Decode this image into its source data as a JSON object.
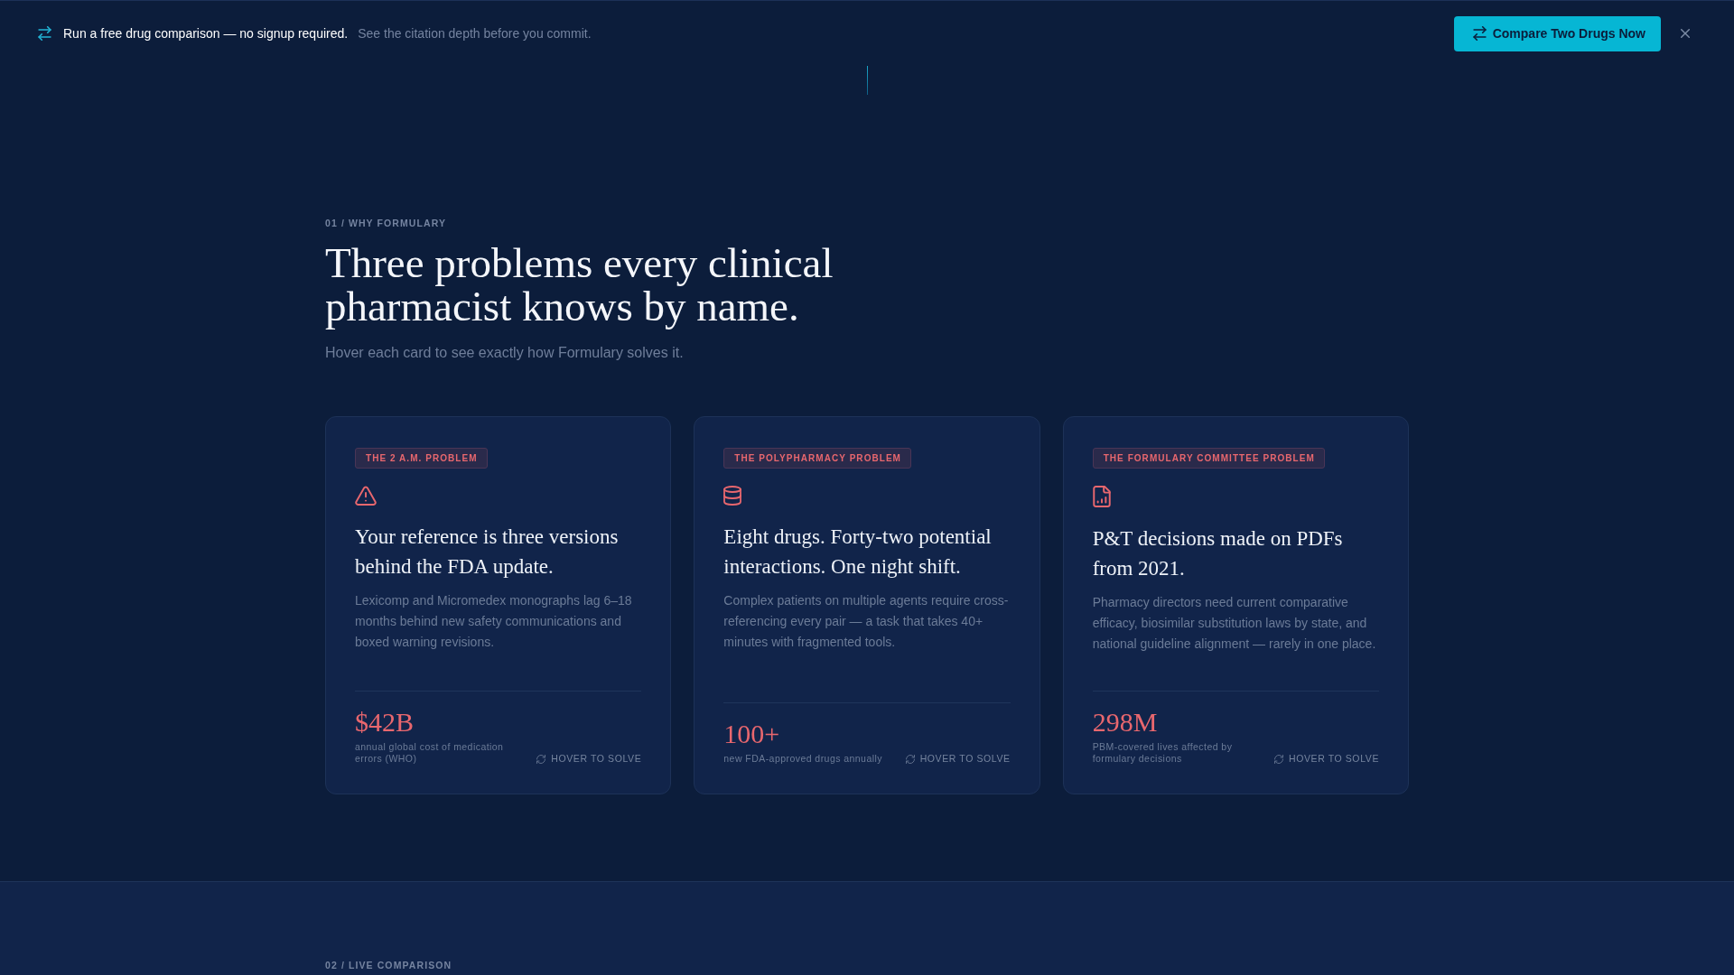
{
  "banner": {
    "message": "Run a free drug comparison — no signup required.",
    "note": "See the citation depth before you commit.",
    "button": "Compare Two Drugs Now"
  },
  "section": {
    "eyebrow": "01 / WHY FORMULARY",
    "title": "Three problems every clinical pharmacist knows by name.",
    "subtitle": "Hover each card to see exactly how Formulary solves it."
  },
  "cards": [
    {
      "kind": "warning",
      "tag": "THE 2 A.M. PROBLEM",
      "title": "Your reference is three versions behind the FDA update.",
      "body": "Lexicomp and Micromedex monographs lag 6–18 months behind new safety communications and boxed warning revisions.",
      "stat": "$42B",
      "stat_label": "annual global cost of medication errors (WHO)",
      "hint": "HOVER TO SOLVE"
    },
    {
      "kind": "database",
      "tag": "THE POLYPHARMACY PROBLEM",
      "title": "Eight drugs. Forty-two potential interactions. One night shift.",
      "body": "Complex patients on multiple agents require cross-referencing every pair — a task that takes 40+ minutes with fragmented tools.",
      "stat": "100+",
      "stat_label": "new FDA-approved drugs annually",
      "hint": "HOVER TO SOLVE"
    },
    {
      "kind": "report",
      "tag": "THE FORMULARY COMMITTEE PROBLEM",
      "title": "P&T decisions made on PDFs from 2021.",
      "body": "Pharmacy directors need current comparative efficacy, biosimilar substitution laws by state, and national guideline alignment — rarely in one place.",
      "stat": "298M",
      "stat_label": "PBM-covered lives affected by formulary decisions",
      "hint": "HOVER TO SOLVE"
    }
  ],
  "next_section": {
    "eyebrow": "02 / LIVE COMPARISON"
  }
}
